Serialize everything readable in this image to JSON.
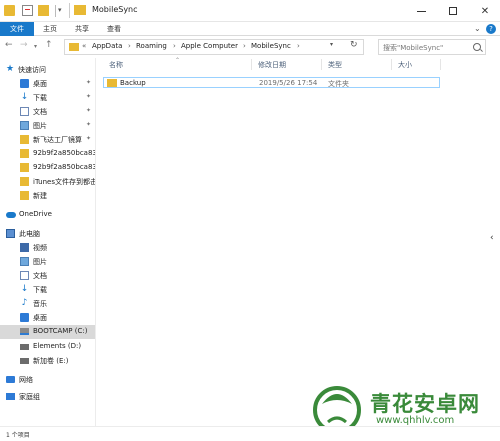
{
  "window": {
    "title": "MobileSync",
    "minimize": "—",
    "maximize": "",
    "close": "✕"
  },
  "ribbon": {
    "tabs": [
      "文件",
      "主页",
      "共享",
      "查看"
    ],
    "help": "?"
  },
  "address_bar": {
    "segments": [
      "AppData",
      "Roaming",
      "Apple Computer",
      "MobileSync"
    ],
    "leading_chevron": "«"
  },
  "search": {
    "placeholder": "搜索\"MobileSync\""
  },
  "sidebar": {
    "items": [
      {
        "label": "快速访问",
        "icon": "star-icon",
        "pinned": false
      },
      {
        "label": "桌面",
        "icon": "desktop-icon",
        "pinned": true
      },
      {
        "label": "下载",
        "icon": "download-icon",
        "pinned": true
      },
      {
        "label": "文档",
        "icon": "document-icon",
        "pinned": true
      },
      {
        "label": "图片",
        "icon": "picture-icon",
        "pinned": true
      },
      {
        "label": "新飞达工厂镜算",
        "icon": "folder-icon",
        "pinned": true
      },
      {
        "label": "92b9f2a850bca83",
        "icon": "folder-icon",
        "pinned": false
      },
      {
        "label": "92b9f2a850bca83",
        "icon": "folder-icon",
        "pinned": false
      },
      {
        "label": "iTunes文件存到都击",
        "icon": "folder-icon",
        "pinned": false
      },
      {
        "label": "新建",
        "icon": "folder-icon",
        "pinned": false
      },
      {
        "label": "OneDrive",
        "icon": "cloud-icon",
        "pinned": false
      },
      {
        "label": "此电脑",
        "icon": "computer-icon",
        "pinned": false
      },
      {
        "label": "视频",
        "icon": "video-icon",
        "pinned": false
      },
      {
        "label": "图片",
        "icon": "picture-icon",
        "pinned": false
      },
      {
        "label": "文档",
        "icon": "document-icon",
        "pinned": false
      },
      {
        "label": "下载",
        "icon": "download-icon",
        "pinned": false
      },
      {
        "label": "音乐",
        "icon": "music-icon",
        "pinned": false
      },
      {
        "label": "桌面",
        "icon": "desktop-icon",
        "pinned": false
      },
      {
        "label": "BOOTCAMP (C:)",
        "icon": "drive-icon",
        "pinned": false
      },
      {
        "label": "Elements (D:)",
        "icon": "drive-icon",
        "pinned": false
      },
      {
        "label": "新加卷 (E:)",
        "icon": "drive-icon",
        "pinned": false
      },
      {
        "label": "网络",
        "icon": "network-icon",
        "pinned": false
      },
      {
        "label": "家庭组",
        "icon": "homegroup-icon",
        "pinned": false
      }
    ],
    "selected": "BOOTCAMP (C:)"
  },
  "columns": [
    "名称",
    "修改日期",
    "类型",
    "大小"
  ],
  "files": [
    {
      "name": "Backup",
      "modified": "2019/5/26 17:54",
      "type": "文件夹",
      "size": ""
    }
  ],
  "status": {
    "count": "1 个项目"
  },
  "watermark": {
    "text": "青花安卓网",
    "url": "www.qhhlv.com"
  },
  "colors": {
    "accent": "#1979ca",
    "folder": "#e8b934",
    "selection": "#d9d9d9",
    "row_border": "#99d1ff",
    "watermark": "#3a8a3a"
  }
}
